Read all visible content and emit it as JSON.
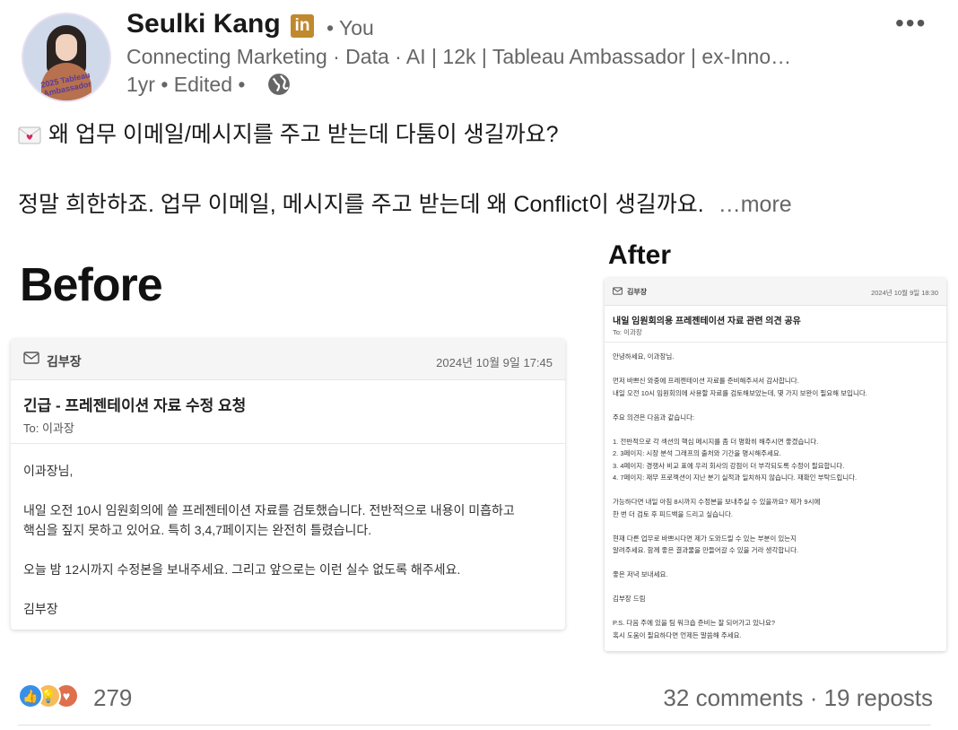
{
  "author": {
    "name": "Seulki Kang",
    "badge": "in",
    "relation": "• You",
    "headline": "Connecting Marketing · Data · AI | 12k | Tableau Ambassador | ex-Inno…",
    "timestamp": "1yr • Edited •",
    "avatar_ring_text": "2025 Tableau Ambassador"
  },
  "post": {
    "line1": "왜 업무 이메일/메시지를 주고 받는데 다툼이 생길까요?",
    "line2": "정말 희한하죠. 업무 이메일, 메시지를 주고 받는데 왜 Conflict이 생길까요.",
    "more": "…more"
  },
  "before": {
    "title": "Before",
    "from": "김부장",
    "date": "2024년 10월 9일 17:45",
    "subject": "긴급 - 프레젠테이션 자료 수정 요청",
    "to": "To: 이과장",
    "body": [
      "이과장님,",
      "",
      "내일 오전 10시 임원회의에 쓸 프레젠테이션 자료를 검토했습니다. 전반적으로 내용이 미흡하고",
      "핵심을 짚지 못하고 있어요. 특히 3,4,7페이지는 완전히 틀렸습니다.",
      "",
      "오늘 밤 12시까지 수정본을 보내주세요. 그리고 앞으로는 이런 실수 없도록 해주세요.",
      "",
      "김부장"
    ]
  },
  "after": {
    "title": "After",
    "from": "김부장",
    "date": "2024년 10월 9일 18:30",
    "subject": "내일 임원회의용 프레젠테이션 자료 관련 의견 공유",
    "to": "To: 이과장",
    "body": [
      "안녕하세요, 이과장님.",
      "",
      "먼저 바쁘신 와중에 프레젠테이션 자료를 준비해주셔서 감사합니다.",
      "내일 오전 10시 임원회의에 사용할 자료를 검토해보았는데, 몇 가지 보완이 필요해 보입니다.",
      "",
      "주요 의견은 다음과 같습니다:",
      "",
      "1. 전반적으로 각 섹션의 핵심 메시지를 좀 더 명확히 해주시면 좋겠습니다.",
      "2. 3페이지: 시장 분석 그래프의 출처와 기간을 명시해주세요.",
      "3. 4페이지: 경쟁사 비교 표에 우리 회사의 강점이 더 부각되도록 수정이 필요합니다.",
      "4. 7페이지: 재무 프로젝션이 지난 분기 실적과 일치하지 않습니다. 재확인 부탁드립니다.",
      "",
      "가능하다면 내일 아침 8시까지 수정본을 보내주실 수 있을까요? 제가 9시에",
      "한 번 더 검토 후 피드백을 드리고 싶습니다.",
      "",
      "현재 다른 업무로 바쁘시다면 제가 도와드릴 수 있는 부분이 있는지",
      "알려주세요. 함께 좋은 결과물을 만들어갈 수 있을 거라 생각합니다.",
      "",
      "좋은 저녁 보내세요.",
      "",
      "김부장 드림",
      "",
      "P.S. 다음 주에 있을 팀 워크숍 준비는 잘 되어가고 있나요?",
      "혹시 도움이 필요하다면 언제든 말씀해 주세요."
    ]
  },
  "footer": {
    "reaction_icons": [
      "like-icon",
      "insightful-icon",
      "love-icon"
    ],
    "reaction_count": "279",
    "comments_reposts": "32 comments · 19 reposts"
  },
  "colors": {
    "linkedin_badge": "#c0892e",
    "muted_text": "#666666",
    "like": "#378fe9",
    "insightful": "#f5bb5c",
    "love": "#df704d"
  }
}
